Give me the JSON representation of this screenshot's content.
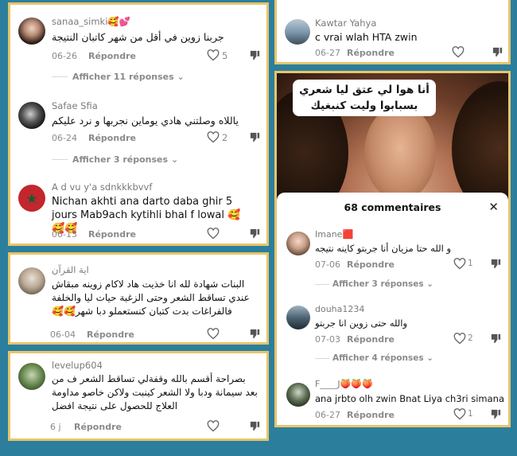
{
  "colors": {
    "background": "#2b7f9c",
    "card_border": "#e7c46b",
    "muted": "#8a8a8a"
  },
  "card1": {
    "c1": {
      "user": "sanaa_simki🥰💕",
      "text": "جربنا زوين في أقل من شهر كاتبان النتيجة",
      "date": "06-26",
      "reply": "Répondre",
      "likes": "5",
      "more": "Afficher 11 réponses"
    },
    "c2": {
      "user": "Safae Sfia",
      "text": "ياللاه وصلتني هادي يوماين نجربها و نرد عليكم",
      "date": "06-24",
      "reply": "Répondre",
      "likes": "2",
      "more": "Afficher 3 réponses"
    },
    "c3": {
      "user": "A d vu y'a sdnkkkbvvf",
      "text": "Nichan akhti ana darto daba ghir 5 jours Mab9ach kytihli bhal f lowal 🥰🥰🥰",
      "date": "06-13",
      "reply": "Répondre"
    }
  },
  "card2": {
    "user": "اية القرآن",
    "text": "البنات شهادة لله انا خذيت هاد لاكام زوينه مبقاش عندي تساقط الشعر وحتى الزغبة حيات ليا والخلفة فالفراغات بدت كتبان كنستعملو دبا شهر🥰🥰",
    "date": "06-04",
    "reply": "Répondre"
  },
  "card3": {
    "user": "levelup604",
    "text": "بصراحة أقسم بالله وقفةلي تساقط الشعر ف من بعد سيمانة ودبا ولا الشعر كينبت ولاكن خاصو مداومة العلاج للحصول على نتيجة افضل",
    "date": "6 j",
    "reply": "Répondre"
  },
  "card4": {
    "user": "Kawtar Yahya",
    "text": "c vrai wlah HTA zwin",
    "date": "06-27",
    "reply": "Répondre"
  },
  "card5": {
    "caption": "أنا هوا لي عتق ليا شعري بسبابوا وليت كنبغيك",
    "header": "68 commentaires",
    "close": "✕",
    "c1": {
      "user": "Imane🟥",
      "text": "و الله حتا مزيان أنا جربتو كاينه نتيجه",
      "date": "07-06",
      "reply": "Répondre",
      "likes": "1",
      "more": "Afficher 3 réponses"
    },
    "c2": {
      "user": "douha1234",
      "text": "والله حتى زوين انا جربتو",
      "date": "07-03",
      "reply": "Répondre",
      "likes": "2",
      "more": "Afficher 4 réponses"
    },
    "c3": {
      "user": "F____J🍑🍑🍑",
      "text": "ana jrbto olh zwin Bnat Liya ch3ri simana",
      "date": "06-27",
      "reply": "Répondre",
      "likes": "1"
    }
  }
}
